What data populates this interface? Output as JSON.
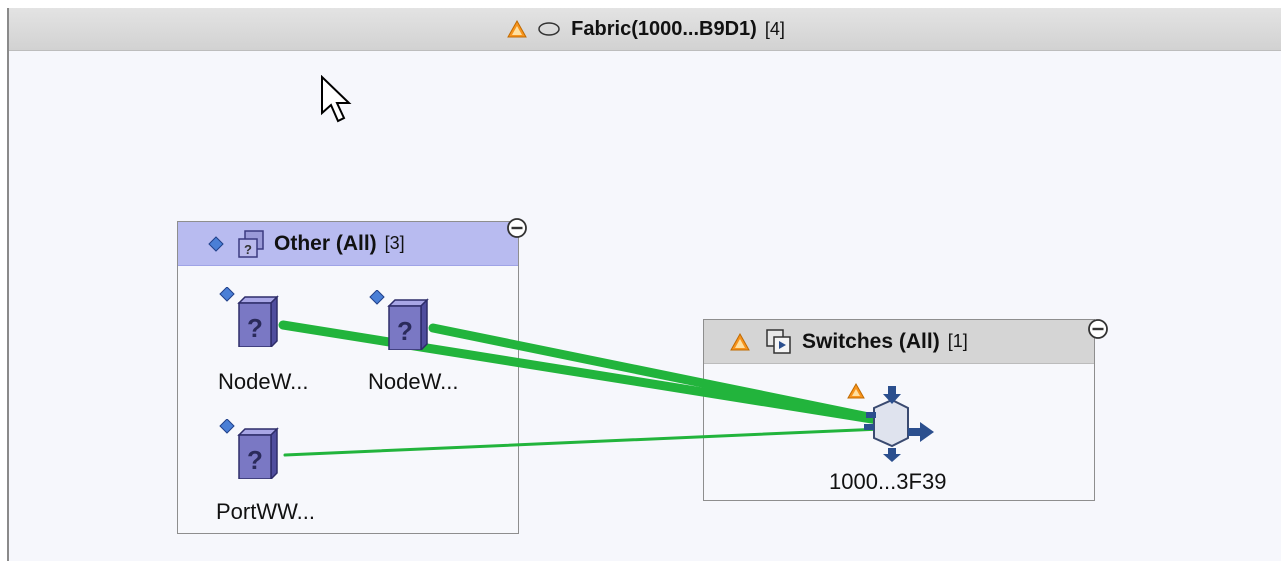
{
  "fabric": {
    "title": "Fabric(1000...B9D1)",
    "count": "[4]",
    "status_icon": "warning-triangle-icon",
    "type_icon": "fabric-ellipse-icon"
  },
  "groups": {
    "other": {
      "title": "Other (All)",
      "count": "[3]",
      "status_icon": "diamond-status-icon",
      "type_icon": "unknown-device-group-icon",
      "header_color": "#b8bbf0",
      "nodes": [
        {
          "label": "NodeW...",
          "icon": "unknown-device-icon"
        },
        {
          "label": "NodeW...",
          "icon": "unknown-device-icon"
        },
        {
          "label": "PortWW...",
          "icon": "unknown-device-icon"
        }
      ]
    },
    "switches": {
      "title": "Switches (All)",
      "count": "[1]",
      "status_icon": "warning-triangle-icon",
      "type_icon": "switch-group-icon",
      "header_color": "#d5d5d5",
      "nodes": [
        {
          "label": "1000...3F39",
          "icon": "switch-icon"
        }
      ]
    }
  },
  "colors": {
    "link": "#22b43c",
    "warning": "#f7941d",
    "diamond": "#4a7fd6",
    "device": "#7a78c4"
  }
}
